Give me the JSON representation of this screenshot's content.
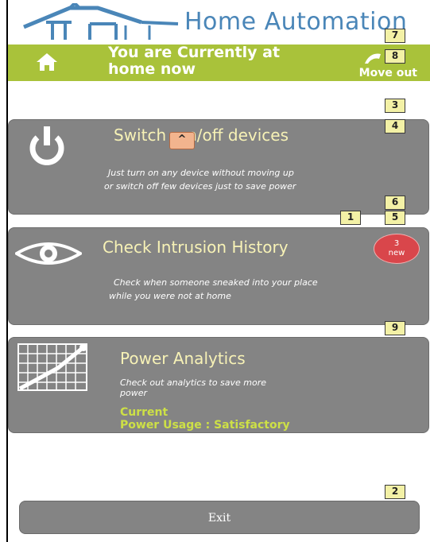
{
  "header": {
    "title": "Home Automation"
  },
  "banner": {
    "status_line1": "You are Currently at",
    "status_line2": "home now",
    "move_out_label": "Move out"
  },
  "cards": {
    "switch": {
      "title_prefix": "Switch",
      "title_suffix": "n/off devices",
      "desc_line1": "Just turn on  any device without moving up",
      "desc_line2": "or switch off few devices just to save power",
      "up_label": "^"
    },
    "intrusion": {
      "title": "Check  Intrusion History",
      "desc_line1": "Check when someone  sneaked into your place",
      "desc_line2": "while you were not at home",
      "new_count": "3",
      "new_label": "new"
    },
    "analytics": {
      "title": "Power Analytics",
      "desc_line1": "Check out  analytics  to save more",
      "desc_line2": "power",
      "status_line1": "Current",
      "status_line2": "Power Usage : Satisfactory"
    }
  },
  "badges": {
    "b1": "1",
    "b2": "2",
    "b3": "3",
    "b4": "4",
    "b5": "5",
    "b6": "6",
    "b7": "7",
    "b8": "8",
    "b9": "9"
  },
  "exit": {
    "label": "Exit"
  },
  "colors": {
    "banner": "#a9c23a",
    "card": "#848484",
    "title": "#f7f2b6",
    "status": "#cde046",
    "accent_blue": "#4a86b8",
    "new_badge": "#d9464b"
  }
}
